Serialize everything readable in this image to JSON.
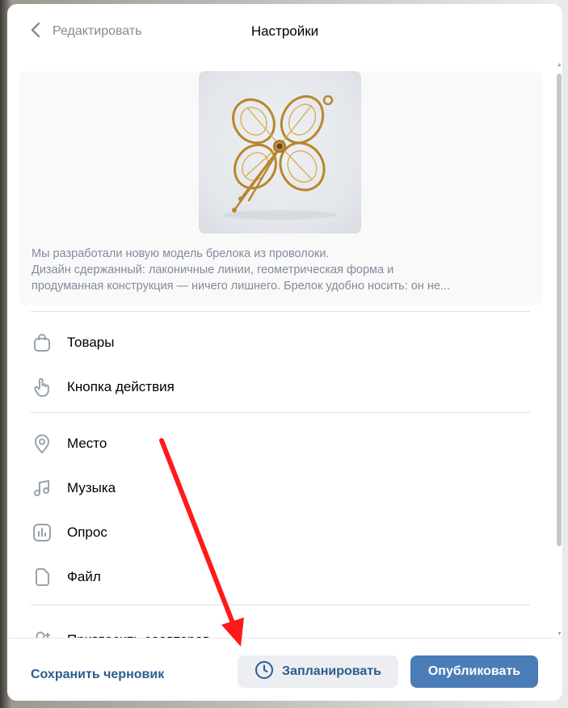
{
  "header": {
    "back_label": "Редактировать",
    "title": "Настройки"
  },
  "post": {
    "image_icon": "wire-keychain-image",
    "text_lines": [
      "Мы разработали новую модель брелока из проволоки.",
      "Дизайн сдержанный: лаконичные линии, геометрическая форма и",
      "продуманная конструкция — ничего лишнего. Брелок удобно носить: он не..."
    ]
  },
  "menu": {
    "items": [
      {
        "label": "Товары",
        "icon": "bag-icon"
      },
      {
        "label": "Кнопка действия",
        "icon": "hand-pointer-icon"
      },
      {
        "label": "Место",
        "icon": "map-pin-icon"
      },
      {
        "label": "Музыка",
        "icon": "music-note-icon"
      },
      {
        "label": "Опрос",
        "icon": "poll-icon"
      },
      {
        "label": "Файл",
        "icon": "file-icon"
      },
      {
        "label": "Пригласить соавторов",
        "icon": "add-user-icon"
      }
    ]
  },
  "footer": {
    "draft_label": "Сохранить черновик",
    "schedule_label": "Запланировать",
    "publish_label": "Опубликовать"
  },
  "colors": {
    "accent": "#2c5d8f",
    "primary_button": "#4a7db8",
    "secondary_text": "#818c99",
    "annotation_arrow": "#ff1a1a"
  }
}
